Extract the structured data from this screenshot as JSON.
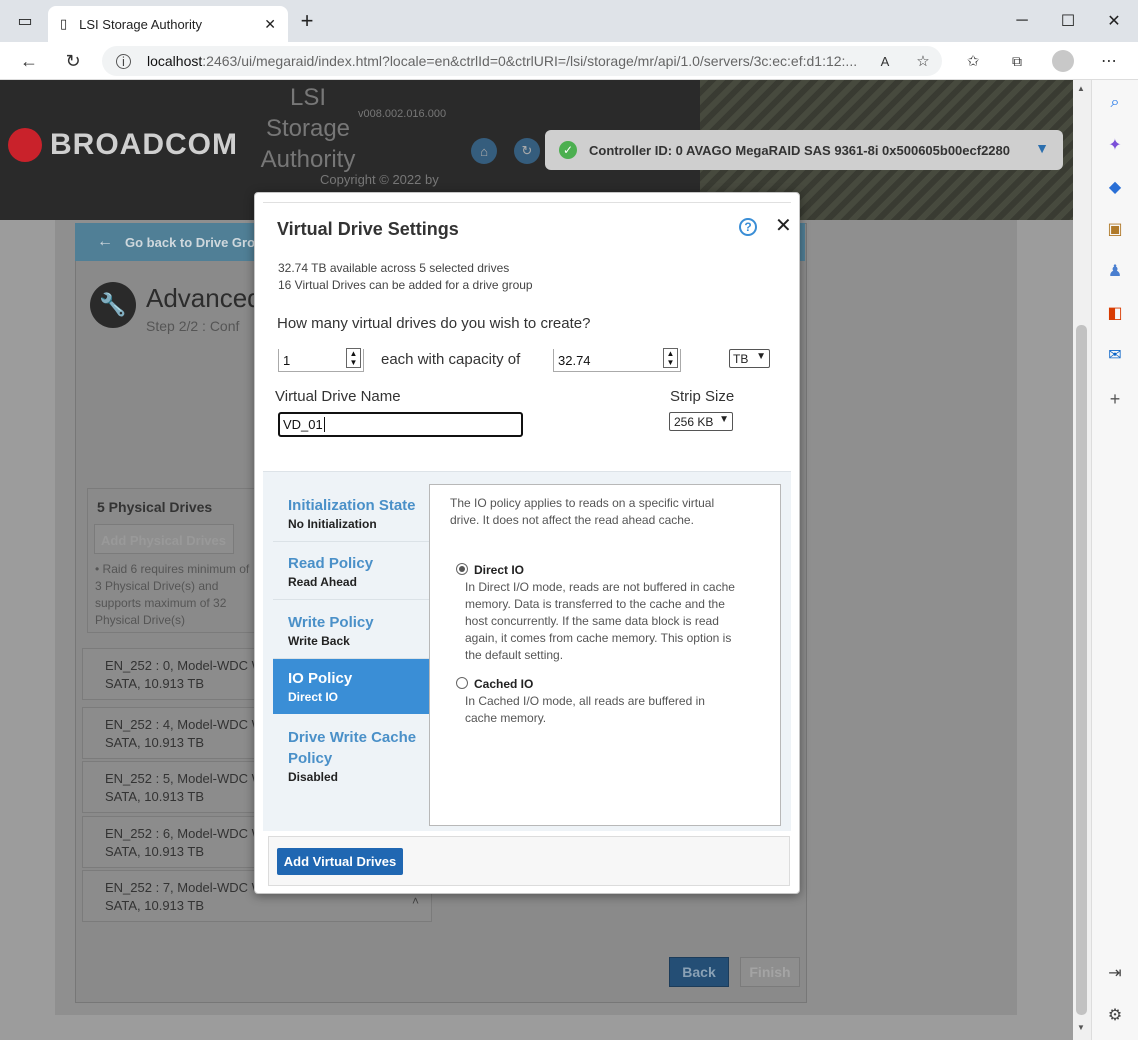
{
  "browser": {
    "tab_title": "LSI Storage Authority",
    "url_host": "localhost",
    "url_path": ":2463/ui/megaraid/index.html?locale=en&ctrlId=0&ctrlURI=/lsi/storage/mr/api/1.0/servers/3c:ec:ef:d1:12:..."
  },
  "header": {
    "brand": "BROADCOM",
    "app_name": "LSI Storage Authority",
    "version": "v008.002.016.000",
    "copyright": "Copyright © 2022 by",
    "controller": "Controller ID: 0 AVAGO MegaRAID SAS 9361-8i 0x500605b00ecf2280"
  },
  "background_page": {
    "go_back": "Go back to Drive Grou",
    "title": "Advanced",
    "step": "Step 2/2 : Conf",
    "physical_drives_title": "5 Physical Drives",
    "add_physical_drives": "Add Physical Drives",
    "raid_note": "• Raid 6 requires minimum of 3 Physical Drive(s) and supports maximum of 32 Physical Drive(s)",
    "drives": [
      {
        "line1": "EN_252 : 0, Model-WDC W",
        "line2": "SATA, 10.913 TB"
      },
      {
        "line1": "EN_252 : 4, Model-WDC W",
        "line2": "SATA, 10.913 TB"
      },
      {
        "line1": "EN_252 : 5, Model-WDC W",
        "line2": "SATA, 10.913 TB"
      },
      {
        "line1": "EN_252 : 6, Model-WDC W",
        "line2": "SATA, 10.913 TB"
      },
      {
        "line1": "EN_252 : 7, Model-WDC W",
        "line2": "SATA, 10.913 TB"
      }
    ],
    "back_button": "Back",
    "finish_button": "Finish"
  },
  "modal": {
    "title": "Virtual Drive Settings",
    "info_available": "32.74 TB available across 5 selected drives",
    "info_count": "16 Virtual Drives can be added for a drive group",
    "how_many_label": "How many virtual drives do you wish to create?",
    "count_value": "1",
    "each_with_label": "each with capacity of",
    "capacity_value": "32.74",
    "capacity_unit": "TB",
    "vd_name_label": "Virtual Drive Name",
    "vd_name_value": "VD_01",
    "strip_size_label": "Strip Size",
    "strip_size_value": "256 KB",
    "settings": [
      {
        "name": "Initialization State",
        "value": "No Initialization"
      },
      {
        "name": "Read Policy",
        "value": "Read Ahead"
      },
      {
        "name": "Write Policy",
        "value": "Write Back"
      },
      {
        "name": "IO Policy",
        "value": "Direct IO"
      },
      {
        "name": "Drive Write Cache Policy",
        "value": "Disabled"
      }
    ],
    "io_description": "The IO policy applies to reads on a specific virtual drive. It does not affect the read ahead cache.",
    "options": [
      {
        "label": "Direct IO",
        "desc": "In Direct I/O mode, reads are not buffered in cache memory. Data is transferred to the cache and the host concurrently. If the same data block is read again, it comes from cache memory. This option is the default setting.",
        "checked": true
      },
      {
        "label": "Cached IO",
        "desc": "In Cached I/O mode, all reads are buffered in cache memory.",
        "checked": false
      }
    ],
    "add_button": "Add Virtual Drives"
  },
  "colors": {
    "accent": "#3a8ed6",
    "primary_button": "#2067b2",
    "brand_red": "#c9222b"
  }
}
